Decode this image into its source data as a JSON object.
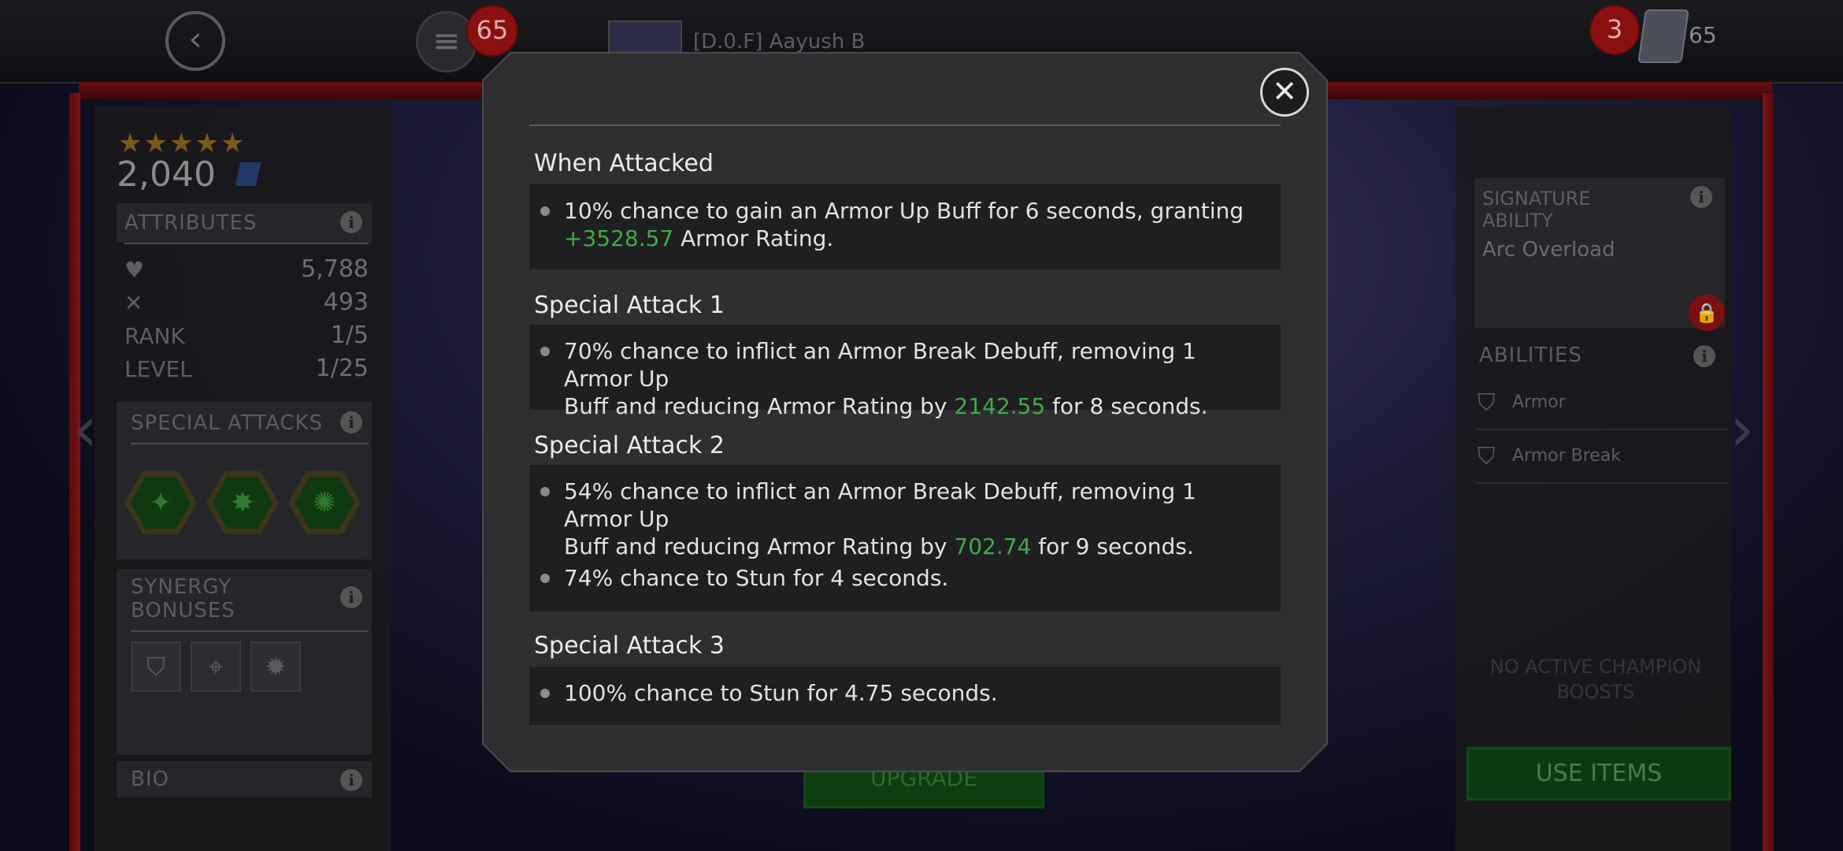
{
  "topbar": {
    "menu_badge": "65",
    "items_badge": "3",
    "items_count": "65",
    "player_alliance": "[D.0.F]",
    "player_name": "Aayush B"
  },
  "champion": {
    "stars": "★★★★★",
    "rating": "2,040"
  },
  "left_panel": {
    "attributes_header": "ATTRIBUTES",
    "health_value": "5,788",
    "attack_value": "493",
    "rank_label": "RANK",
    "rank_value": "1/5",
    "level_label": "LEVEL",
    "level_value": "1/25",
    "special_attacks_header": "SPECIAL ATTACKS",
    "synergy_header_line1": "SYNERGY",
    "synergy_header_line2": "BONUSES",
    "bio_header": "BIO"
  },
  "right_panel": {
    "signature_label_line1": "SIGNATURE",
    "signature_label_line2": "ABILITY",
    "signature_name": "Arc Overload",
    "abilities_header": "ABILITIES",
    "abilities": [
      {
        "icon": "shield-icon",
        "label": "Armor"
      },
      {
        "icon": "broken-shield-icon",
        "label": "Armor Break"
      }
    ],
    "no_boosts_line1": "NO ACTIVE CHAMPION",
    "no_boosts_line2": "BOOSTS",
    "use_items_label": "USE ITEMS"
  },
  "upgrade_label": "UPGRADE",
  "modal": {
    "close_symbol": "✕",
    "sections": [
      {
        "title": "When Attacked",
        "bullets": [
          {
            "line1_pre": "10% chance to gain an Armor Up Buff for 6 seconds, granting",
            "line2_green": "+3528.57",
            "line2_post": " Armor Rating."
          }
        ]
      },
      {
        "title": "Special Attack 1",
        "bullets": [
          {
            "line1_pre": "70% chance to inflict an Armor Break Debuff, removing 1 Armor Up",
            "line2_pre": "Buff and reducing Armor Rating by ",
            "line2_green": "2142.55",
            "line2_post": " for 8 seconds."
          }
        ]
      },
      {
        "title": "Special Attack 2",
        "bullets": [
          {
            "line1_pre": "54% chance to inflict an Armor Break Debuff, removing 1 Armor Up",
            "line2_pre": "Buff and reducing Armor Rating by ",
            "line2_green": "702.74",
            "line2_post": " for 9 seconds."
          },
          {
            "line1_pre": "74% chance to Stun for 4 seconds."
          }
        ]
      },
      {
        "title": "Special Attack 3",
        "bullets": [
          {
            "line1_pre": "100% chance to Stun for 4.75 seconds."
          }
        ]
      }
    ]
  },
  "colors": {
    "highlight_green": "#3faa4a",
    "modal_bg": "#2f2f31",
    "row_bg": "#1f1f21"
  }
}
